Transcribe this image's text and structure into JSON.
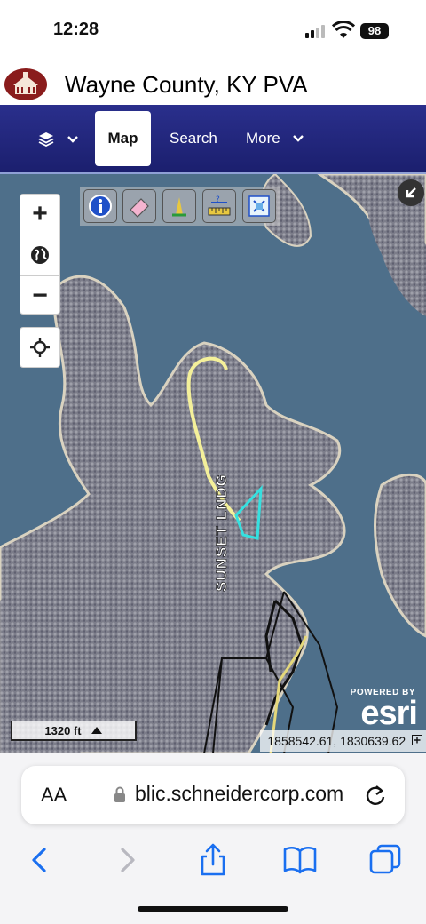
{
  "status_bar": {
    "time": "12:28",
    "battery": "98",
    "icons": [
      "signal-icon",
      "wifi-icon",
      "battery-icon"
    ]
  },
  "site": {
    "title": "Wayne County, KY PVA",
    "logo_icon": "courthouse-seal-icon"
  },
  "nav": {
    "layers_icon": "layers-icon",
    "tabs": [
      {
        "label": "Map",
        "active": true
      },
      {
        "label": "Search",
        "active": false
      },
      {
        "label": "More",
        "active": false
      }
    ],
    "colors": {
      "bar": "#1f2478",
      "active_tab": "#ffffff"
    }
  },
  "map": {
    "controls": {
      "zoom_in": "+",
      "zoom_out": "−",
      "icons": [
        "zoom-in-icon",
        "globe-icon",
        "zoom-out-icon",
        "locate-crosshair-icon",
        "collapse-arrow-icon"
      ]
    },
    "tools": [
      {
        "name": "identify",
        "icon": "info-icon"
      },
      {
        "name": "eraser",
        "icon": "eraser-icon"
      },
      {
        "name": "draw",
        "icon": "pencil-icon"
      },
      {
        "name": "measure",
        "icon": "measure-icon"
      },
      {
        "name": "print",
        "icon": "print-icon"
      }
    ],
    "road_label": "SUNSET LNDG",
    "scale_label": "1320 ft",
    "coordinates": "1858542.61, 1830639.62",
    "attribution_small": "POWERED BY",
    "attribution_brand": "esri",
    "colors": {
      "water": "#4e6f8a",
      "road_highlight": "#f4f09a",
      "parcel_selection": "#35e0e0"
    }
  },
  "browser": {
    "text_size_label": "AA",
    "url": "blic.schneidercorp.com",
    "icons": [
      "lock-icon",
      "reload-icon",
      "back-icon",
      "forward-icon",
      "share-icon",
      "bookmarks-icon",
      "tabs-icon"
    ]
  }
}
